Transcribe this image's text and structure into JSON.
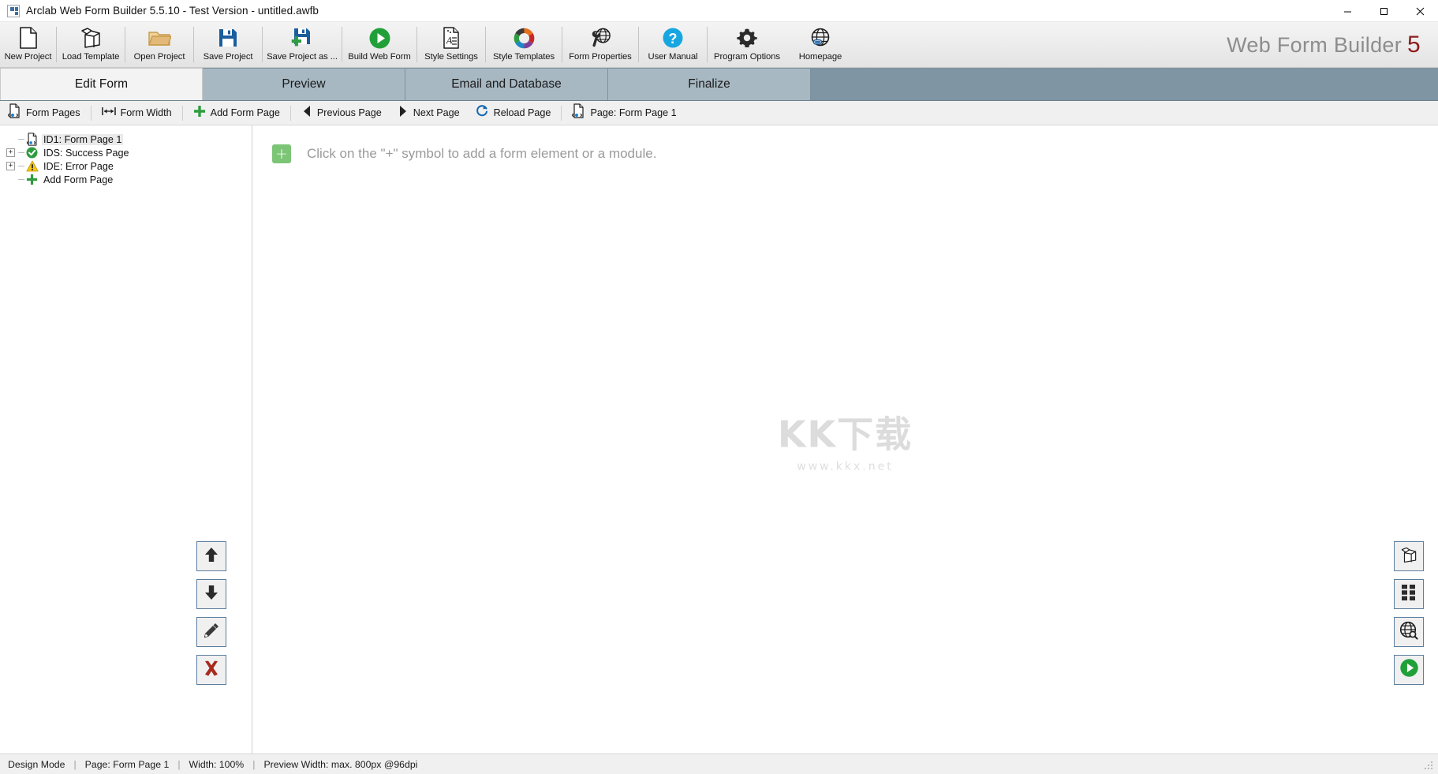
{
  "window": {
    "title": "Arclab Web Form Builder 5.5.10 - Test Version - untitled.awfb",
    "minimize": "─",
    "maximize": "☐",
    "close": "✕"
  },
  "toolbar": {
    "items": [
      {
        "label": "New Project",
        "icon": "page-icon"
      },
      {
        "label": "Load Template",
        "icon": "template-box-icon"
      },
      {
        "label": "Open Project",
        "icon": "open-folder-icon"
      },
      {
        "label": "Save Project",
        "icon": "floppy-disk-icon"
      },
      {
        "label": "Save Project as ...",
        "icon": "floppy-disk-plus-icon"
      },
      {
        "label": "Build Web Form",
        "icon": "green-play-icon"
      },
      {
        "label": "Style Settings",
        "icon": "style-document-icon"
      },
      {
        "label": "Style Templates",
        "icon": "color-wheel-icon"
      },
      {
        "label": "Form Properties",
        "icon": "wrench-globe-icon"
      },
      {
        "label": "User Manual",
        "icon": "question-help-icon"
      },
      {
        "label": "Program Options",
        "icon": "gear-icon"
      },
      {
        "label": "Homepage",
        "icon": "globe-link-icon"
      }
    ],
    "brand_text": "Web Form Builder",
    "brand_number": "5",
    "brand_color": "#8d8d8d",
    "brand_number_color": "#8c1d1d"
  },
  "tabs": [
    {
      "label": "Edit Form",
      "active": true
    },
    {
      "label": "Preview",
      "active": false
    },
    {
      "label": "Email and Database",
      "active": false
    },
    {
      "label": "Finalize",
      "active": false
    }
  ],
  "subtoolbar": {
    "items": [
      {
        "label": "Form Pages",
        "icon": "form-page-icon"
      },
      {
        "label": "Form Width",
        "icon": "width-arrows-icon"
      },
      {
        "label": "Add Form Page",
        "icon": "green-plus-icon"
      },
      {
        "label": "Previous Page",
        "icon": "triangle-left-icon"
      },
      {
        "label": "Next Page",
        "icon": "triangle-right-icon"
      },
      {
        "label": "Reload Page",
        "icon": "reload-circle-icon"
      },
      {
        "label": "Page: Form Page 1",
        "icon": "form-page-icon"
      }
    ]
  },
  "sidebar": {
    "tree": [
      {
        "label": "ID1: Form Page 1",
        "icon": "form-page-icon",
        "expander": "",
        "selected": true
      },
      {
        "label": "IDS: Success Page",
        "icon": "success-check-icon",
        "expander": "+",
        "selected": false
      },
      {
        "label": "IDE: Error Page",
        "icon": "warning-icon",
        "expander": "+",
        "selected": false
      },
      {
        "label": "Add Form Page",
        "icon": "green-plus-icon",
        "expander": "",
        "selected": false
      }
    ]
  },
  "canvas": {
    "placeholder_text": "Click on the \"+\" symbol to add a form element or a module.",
    "plus_symbol": "+",
    "plus_color": "#7cc576",
    "watermark_main": "KK下载",
    "watermark_sub": "www.kkx.net"
  },
  "left_tools": [
    {
      "name": "move-up-button",
      "icon": "arrow-up-icon"
    },
    {
      "name": "move-down-button",
      "icon": "arrow-down-icon"
    },
    {
      "name": "edit-button",
      "icon": "pencil-icon"
    },
    {
      "name": "delete-button",
      "icon": "red-x-icon"
    }
  ],
  "right_tools": [
    {
      "name": "load-template-button",
      "icon": "template-box-icon"
    },
    {
      "name": "modules-button",
      "icon": "grid-icon"
    },
    {
      "name": "preview-web-button",
      "icon": "globe-search-icon"
    },
    {
      "name": "build-button",
      "icon": "green-play-icon"
    }
  ],
  "statusbar": {
    "mode": "Design Mode",
    "page": "Page: Form Page 1",
    "width": "Width: 100%",
    "preview_width": "Preview Width: max. 800px @96dpi",
    "separator": "|"
  }
}
